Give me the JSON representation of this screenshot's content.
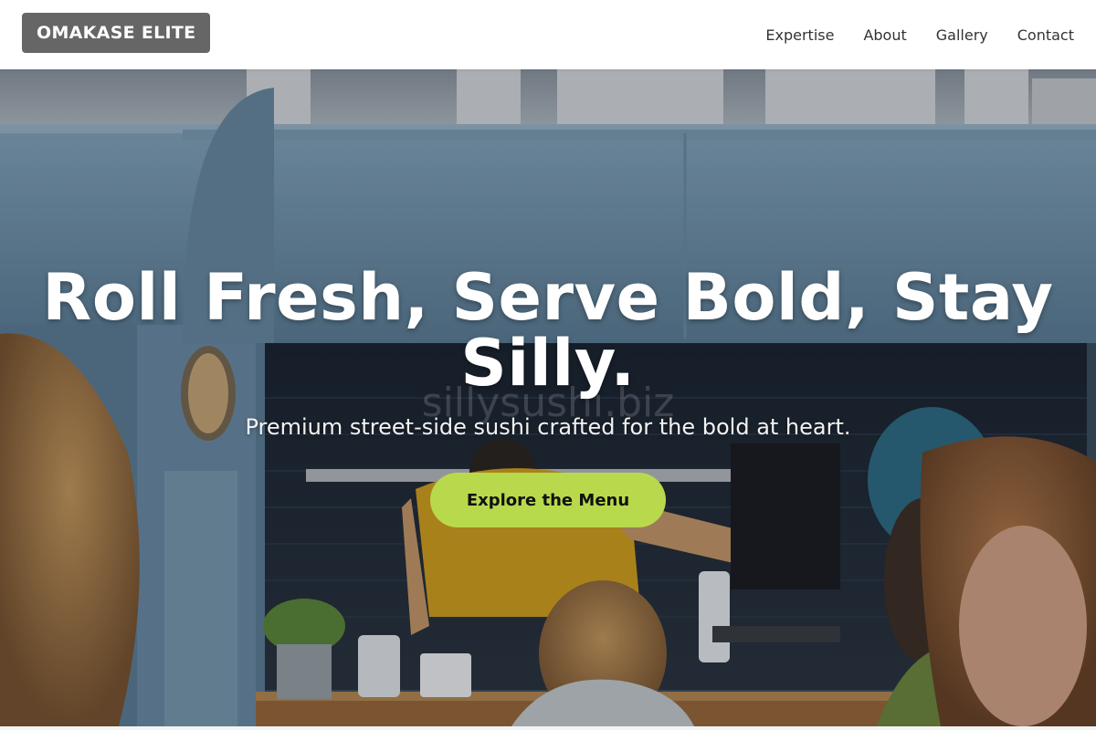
{
  "brand": {
    "logo_text": "OMAKASE ELITE"
  },
  "nav": {
    "items": [
      {
        "label": "Expertise"
      },
      {
        "label": "About"
      },
      {
        "label": "Gallery"
      },
      {
        "label": "Contact"
      }
    ]
  },
  "hero": {
    "headline": "Roll Fresh, Serve Bold, Stay Silly.",
    "subtitle": "Premium street-side sushi crafted for the bold at heart.",
    "cta_label": "Explore the Menu",
    "watermark": "sillysushi.biz",
    "image_alt": "Customers gathered at a blue sushi food truck window"
  },
  "colors": {
    "logo_bg": "#666666",
    "cta_bg": "#b9d94d",
    "truck_blue": "#6f93ad"
  }
}
